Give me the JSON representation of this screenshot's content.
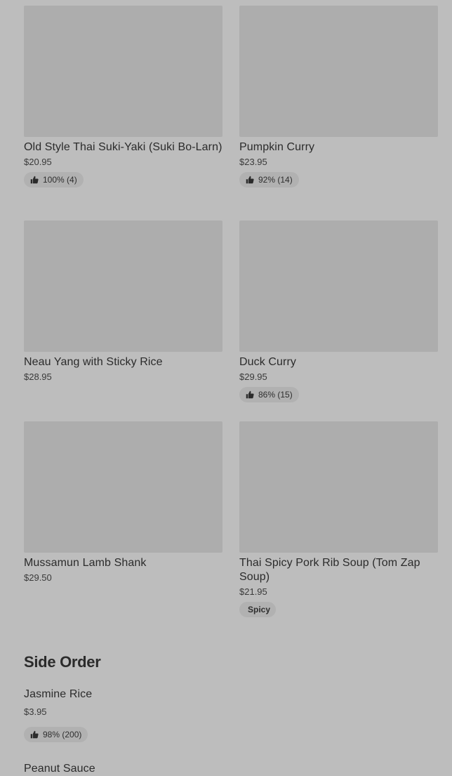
{
  "menu_items": [
    {
      "name": "Old Style Thai Suki-Yaki (Suki Bo-Larn)",
      "price": "$20.95",
      "rating": "100% (4)"
    },
    {
      "name": "Pumpkin Curry",
      "price": "$23.95",
      "rating": "92% (14)"
    },
    {
      "name": "Neau Yang with Sticky Rice",
      "price": "$28.95"
    },
    {
      "name": "Duck Curry",
      "price": "$29.95",
      "rating": "86% (15)"
    },
    {
      "name": "Mussamun Lamb Shank",
      "price": "$29.50"
    },
    {
      "name": "Thai Spicy Pork Rib Soup (Tom Zap Soup)",
      "price": "$21.95",
      "tag": "Spicy"
    }
  ],
  "side_order": {
    "title": "Side Order",
    "items": [
      {
        "name": "Jasmine Rice",
        "price": "$3.95",
        "rating": "98% (200)"
      },
      {
        "name": "Peanut Sauce"
      }
    ]
  },
  "icons": {
    "rating": "thumbs-up-icon"
  }
}
